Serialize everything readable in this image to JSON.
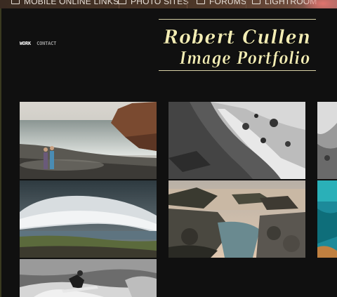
{
  "bookmarks": [
    {
      "label": "MOBILE ONLINE LINKS",
      "icon": "folder-icon"
    },
    {
      "label": "PHOTO SITES",
      "icon": "folder-icon"
    },
    {
      "label": "FORUMS",
      "icon": "folder-icon"
    },
    {
      "label": "LIGHTROOM",
      "icon": "folder-icon"
    }
  ],
  "nav": {
    "items": [
      {
        "label": "WORK",
        "active": true
      },
      {
        "label": "CONTACT",
        "active": false
      }
    ]
  },
  "logo": {
    "line1": "Robert Cullen",
    "line2": "Image Portfolio",
    "text_color": "#f3edb4",
    "rule_color": "#d8d2a6"
  },
  "gallery": {
    "tiles": [
      {
        "name": "coastal-couple-photo"
      },
      {
        "name": "black-white-rocky-shore-photo"
      },
      {
        "name": "partial-coast-photo-right"
      },
      {
        "name": "storm-cloud-seascape-photo"
      },
      {
        "name": "rock-pools-sunset-photo"
      },
      {
        "name": "partial-turquoise-bay-photo"
      },
      {
        "name": "surfer-black-white-photo"
      }
    ]
  },
  "colors": {
    "background": "#101010",
    "bookmark_bar": "#4a3526"
  }
}
